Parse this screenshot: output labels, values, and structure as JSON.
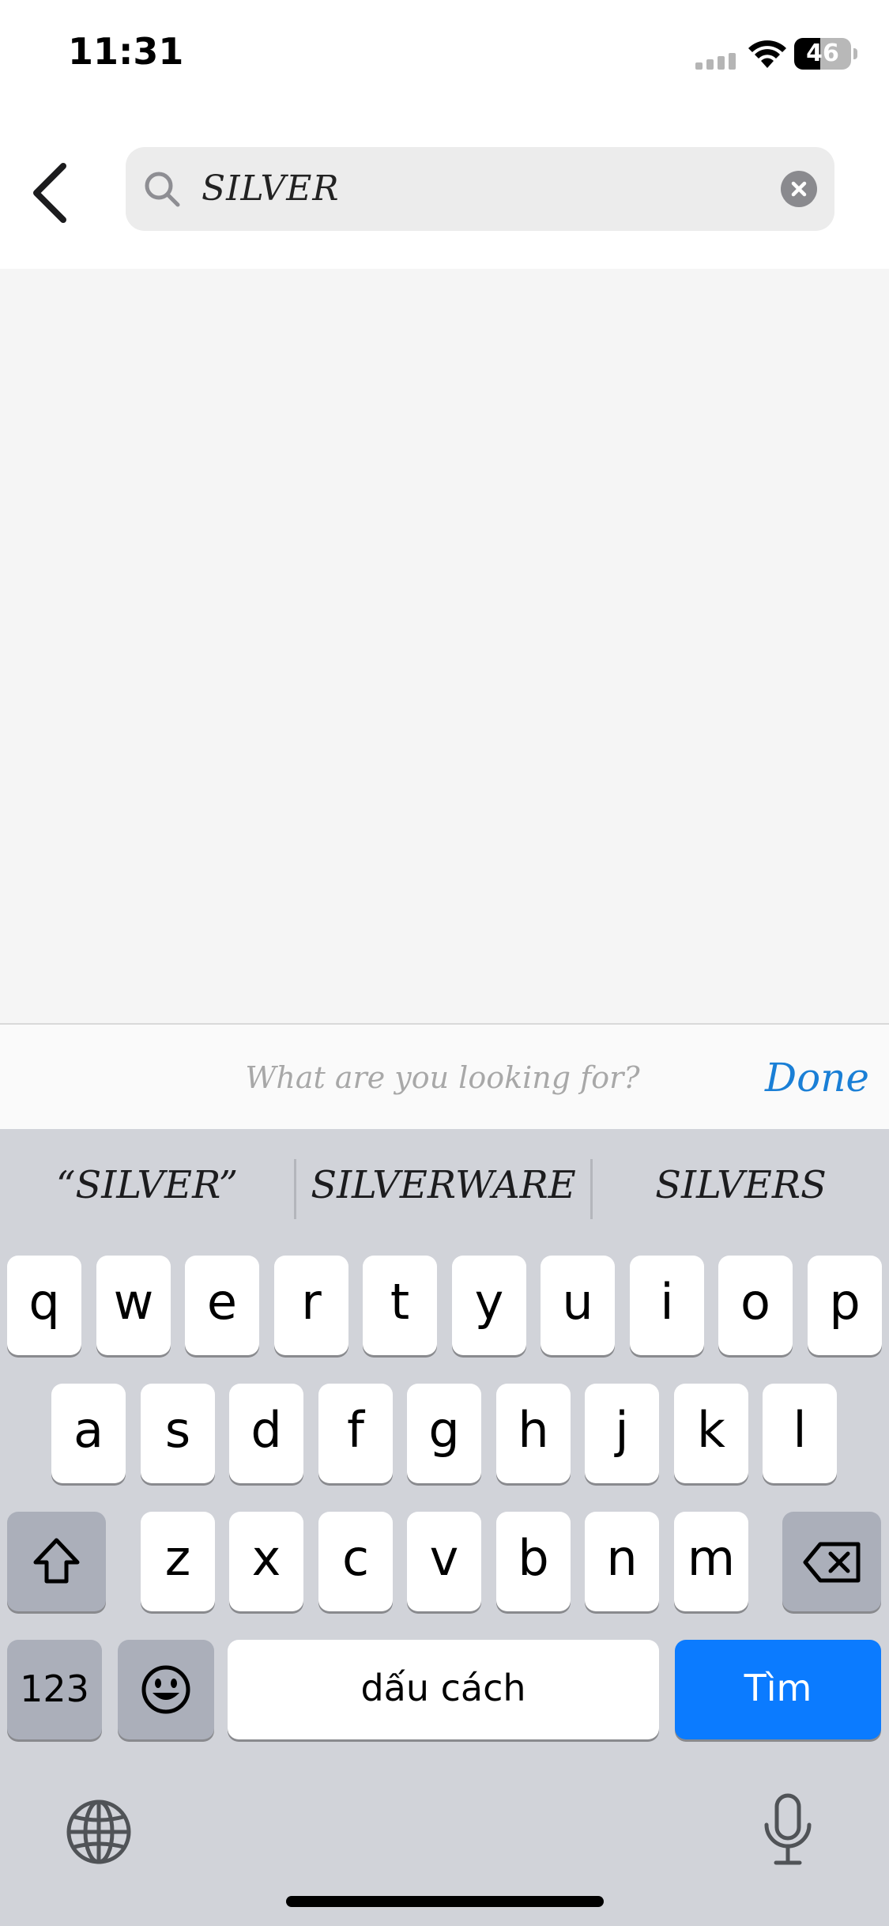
{
  "status_bar": {
    "time": "11:31",
    "battery_level": "46",
    "battery_fraction": 0.46
  },
  "search": {
    "query": "SILVER"
  },
  "accessory": {
    "placeholder": "What are you looking for?",
    "done_label": "Done"
  },
  "keyboard": {
    "suggestions": [
      "“SILVER”",
      "SILVERWARE",
      "SILVERS"
    ],
    "row1": [
      "q",
      "w",
      "e",
      "r",
      "t",
      "y",
      "u",
      "i",
      "o",
      "p"
    ],
    "row2": [
      "a",
      "s",
      "d",
      "f",
      "g",
      "h",
      "j",
      "k",
      "l"
    ],
    "row3": [
      "z",
      "x",
      "c",
      "v",
      "b",
      "n",
      "m"
    ],
    "numbers_label": "123",
    "space_label": "dấu cách",
    "search_label": "Tìm"
  },
  "icons": {
    "back": "chevron-left-icon",
    "search": "magnifier-icon",
    "clear": "x-circle-icon",
    "shift": "shift-icon",
    "backspace": "backspace-icon",
    "emoji": "emoji-icon",
    "globe": "globe-icon",
    "mic": "microphone-icon"
  },
  "colors": {
    "accent": "#1a7fd6",
    "key_blue": "#0b7bff",
    "keyboard_bg": "#d1d3d9"
  }
}
